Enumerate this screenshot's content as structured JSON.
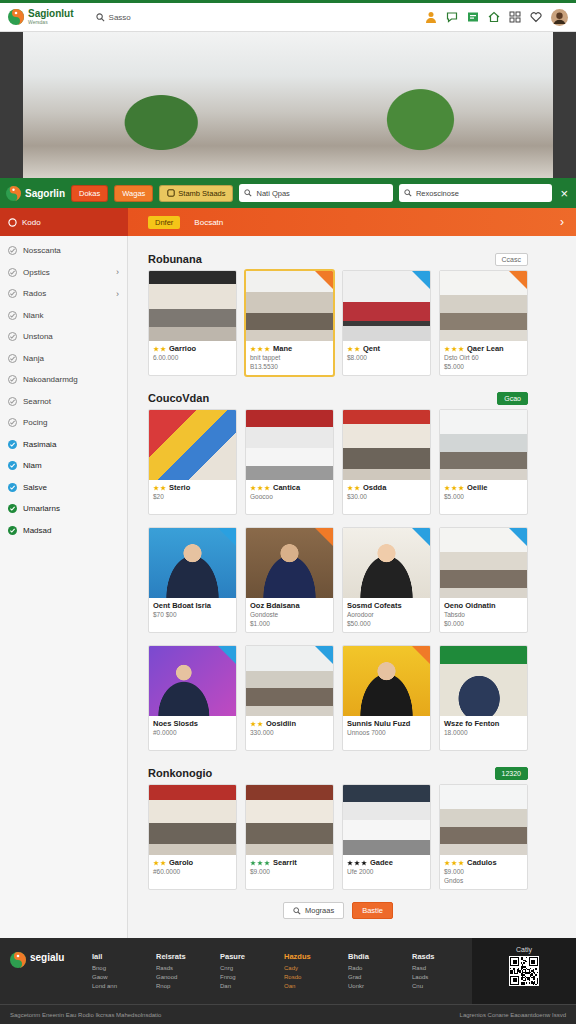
{
  "topbar": {
    "logo": "Sagionlut",
    "logo_sub": "Wersdas",
    "search": "Sasso"
  },
  "navbar": {
    "logo": "Sagorlin",
    "buttons": [
      {
        "label": "Dokas",
        "color": "#e8501e"
      },
      {
        "label": "Wagas",
        "color": "#f07a28"
      },
      {
        "label": "Stamb Staads",
        "color": "#e9c75e"
      }
    ],
    "search": "Nati Qpas",
    "search2": "Rexoscinose",
    "close": "×"
  },
  "filterbar": {
    "category": "Kodo",
    "badge": "Dnfer",
    "label": "Bocsatn",
    "chevron": "›"
  },
  "sidebar": {
    "items": [
      {
        "label": "Nosscanta",
        "checked": false,
        "color": "#9a9a9a"
      },
      {
        "label": "Opstics",
        "checked": false,
        "color": "#9a9a9a",
        "arrow": "›"
      },
      {
        "label": "Rados",
        "checked": false,
        "color": "#9a9a9a",
        "arrow": "›"
      },
      {
        "label": "Nlank",
        "checked": false,
        "color": "#9a9a9a"
      },
      {
        "label": "Unstona",
        "checked": false,
        "color": "#9a9a9a"
      },
      {
        "label": "Nanja",
        "checked": false,
        "color": "#9a9a9a"
      },
      {
        "label": "Nakoandarmdg",
        "checked": false,
        "color": "#9a9a9a"
      },
      {
        "label": "Searnot",
        "checked": false,
        "color": "#9a9a9a"
      },
      {
        "label": "Pocing",
        "checked": false,
        "color": "#9a9a9a"
      },
      {
        "label": "Rasimaia",
        "checked": true,
        "color": "#2a9fd8"
      },
      {
        "label": "Nlam",
        "checked": true,
        "color": "#2a9fd8"
      },
      {
        "label": "Salsve",
        "checked": true,
        "color": "#2a9fd8"
      },
      {
        "label": "Umarlarns",
        "checked": true,
        "color": "#1f8a3a"
      },
      {
        "label": "Madsad",
        "checked": true,
        "color": "#1f8a3a"
      }
    ]
  },
  "sections": [
    {
      "title": "Robunana",
      "button": {
        "label": "Ccasc",
        "kind": "outline"
      },
      "cards": [
        {
          "title": "Garrioo",
          "lines": [
            "6.00.000"
          ],
          "stars": 2,
          "color": "#f0b400",
          "selected": false
        },
        {
          "title": "Mane",
          "lines": [
            "bnit tappet",
            "B13.5530"
          ],
          "stars": 3,
          "color": "#f0b400",
          "tag_color": "#f07a28",
          "selected": true
        },
        {
          "title": "Qent",
          "lines": [
            "$8.000"
          ],
          "stars": 2,
          "color": "#f0b400",
          "tag_color": "#2aa0e0",
          "selected": false
        },
        {
          "title": "Qaer Lean",
          "lines": [
            "Dsto Oirt 60",
            "$5.000"
          ],
          "stars": 3,
          "color": "#f0b400",
          "tag_color": "#f07a28",
          "selected": false
        }
      ]
    },
    {
      "title": "CoucoVdan",
      "button": {
        "label": "Gcao",
        "kind": "filled"
      },
      "cards": [
        {
          "title": "Sterio",
          "lines": [
            "$20"
          ],
          "stars": 2,
          "color": "#f0b400",
          "selected": false
        },
        {
          "title": "Cantica",
          "lines": [
            "Goocoo"
          ],
          "stars": 3,
          "color": "#f0b400",
          "selected": false
        },
        {
          "title": "Osdda",
          "lines": [
            "$30.00"
          ],
          "stars": 2,
          "color": "#f0b400",
          "selected": false
        },
        {
          "title": "Oeilie",
          "lines": [
            "$5.000"
          ],
          "stars": 3,
          "color": "#f0b400",
          "selected": false
        },
        {
          "title": "Oent Bdoat Isria",
          "lines": [
            "$70 $00"
          ],
          "stars": 0,
          "tag_color": "#2aa0e0",
          "selected": false
        },
        {
          "title": "Ooz Bdaisana",
          "lines": [
            "Gondoste",
            "$1.000"
          ],
          "stars": 0,
          "tag_color": "#f07a28",
          "selected": false
        },
        {
          "title": "Sosmd Cofeats",
          "lines": [
            "Aorodoor",
            "$50.000"
          ],
          "stars": 0,
          "tag_color": "#2aa0e0",
          "selected": false
        },
        {
          "title": "Oeno Oidnatin",
          "lines": [
            "Tabsdo",
            "$0.000"
          ],
          "stars": 0,
          "tag_color": "#2aa0e0",
          "selected": false
        },
        {
          "title": "Noes Slosds",
          "lines": [
            "#0.0000"
          ],
          "stars": 0,
          "tag_color": "#2aa0e0",
          "selected": false
        },
        {
          "title": "Oosidiin",
          "lines": [
            "330.000"
          ],
          "stars": 2,
          "color": "#f0b400",
          "tag_color": "#2aa0e0",
          "selected": false
        },
        {
          "title": "Sunnis Nulu Fuzd",
          "lines": [
            "Unnoos 7000"
          ],
          "stars": 0,
          "tag_color": "#f07a28",
          "selected": false
        },
        {
          "title": "Wsze fo Fenton",
          "lines": [
            "18.0000"
          ],
          "stars": 0,
          "selected": false
        }
      ]
    },
    {
      "title": "Ronkonogio",
      "button": {
        "label": "12320",
        "kind": "filled"
      },
      "cards": [
        {
          "title": "Garolo",
          "lines": [
            "#60.0000"
          ],
          "stars": 2,
          "color": "#f0b400",
          "selected": false
        },
        {
          "title": "Searrit",
          "lines": [
            "$9.000"
          ],
          "stars": 3,
          "color": "#2e9e4f",
          "selected": false
        },
        {
          "title": "Gadee",
          "lines": [
            "Ufe 2000"
          ],
          "stars": 3,
          "color": "#111111",
          "selected": false
        },
        {
          "title": "Cadulos",
          "lines": [
            "$9.000",
            "Gndos"
          ],
          "stars": 3,
          "color": "#f0b400",
          "selected": false
        }
      ]
    }
  ],
  "pagination": [
    {
      "label": "Mograas",
      "selected": false
    },
    {
      "label": "Bastie",
      "selected": true
    }
  ],
  "footer": {
    "logo": "segialu",
    "columns": [
      {
        "title": "Iail",
        "links": [
          "Bnog",
          "Gaow",
          "Lond ann"
        ],
        "selected": false
      },
      {
        "title": "Relsrats",
        "links": [
          "Rasds",
          "Ganood",
          "Rnop"
        ],
        "selected": false
      },
      {
        "title": "Pasure",
        "links": [
          "Cnrg",
          "Fnrog",
          "Dan"
        ],
        "selected": false
      },
      {
        "title": "Hazdus",
        "links": [
          "Cady",
          "Rosdo",
          "Oan"
        ],
        "selected": true
      },
      {
        "title": "Bhdia",
        "links": [
          "Rado",
          "Grad",
          "Uonkr"
        ],
        "selected": false
      },
      {
        "title": "Rasds",
        "links": [
          "Rasd",
          "Laods",
          "Cnu"
        ],
        "selected": false
      }
    ],
    "qr_label": "Catiy",
    "bottom_left": "Sagcetonm Eneenin Eau Rodio Ikcrsas Mahedsolnsdatio",
    "bottom_right": "Lagrenios Conane Eaoaantdoenw Issvd"
  }
}
